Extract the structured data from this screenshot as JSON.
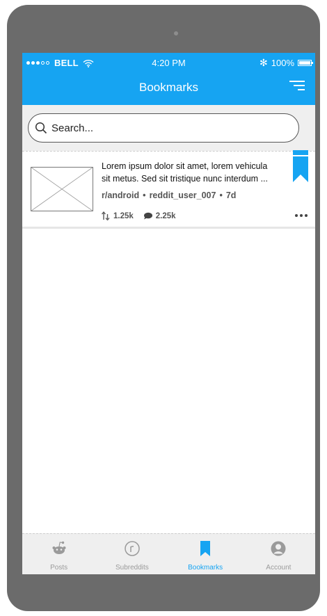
{
  "status_bar": {
    "carrier": "BELL",
    "time": "4:20 PM",
    "battery": "100%",
    "bluetooth_symbol": "✻",
    "signal_bars_filled": 3,
    "signal_bars_total": 5,
    "battery_level": 1.0
  },
  "header": {
    "title": "Bookmarks",
    "sort_icon": "sort-icon"
  },
  "search": {
    "placeholder": "Search..."
  },
  "posts": [
    {
      "line1": "Lorem ipsum dolor sit amet, lorem vehicula",
      "line2": "sit metus. Sed sit tristique nunc interdum ...",
      "subreddit": "r/android",
      "user": "reddit_user_007",
      "age": "7d",
      "separator": "•",
      "votes": "1.25k",
      "comments": "2.25k",
      "bookmarked": true
    }
  ],
  "tabs": [
    {
      "label": "Posts",
      "icon": "reddit-alien-icon",
      "active": false
    },
    {
      "label": "Subreddits",
      "icon": "subreddit-r-icon",
      "active": false
    },
    {
      "label": "Bookmarks",
      "icon": "bookmark-icon",
      "active": true
    },
    {
      "label": "Account",
      "icon": "account-icon",
      "active": false
    }
  ],
  "colors": {
    "accent": "#16a4f2",
    "device_frame": "#6b6b6b",
    "search_bar_bg": "#efefef",
    "tab_inactive": "#9a9a9a"
  }
}
